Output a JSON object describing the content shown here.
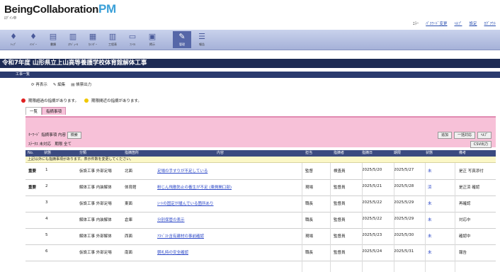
{
  "header": {
    "logo_main": "BeingCollaboration",
    "logo_pm": "PM",
    "subtitle": "ﾛｸﾞｲﾝ中",
    "links": [
      {
        "label": "ｴﾗｰ",
        "link": false
      },
      {
        "label": "ﾊﾟｽﾜｰﾄﾞ変更",
        "link": true
      },
      {
        "label": "ﾍﾙﾌﾟ",
        "link": true
      },
      {
        "label": "設定",
        "link": true
      },
      {
        "label": "ﾛｸﾞｱｳﾄ",
        "link": true
      }
    ]
  },
  "toolbar": {
    "items": [
      {
        "icon": "person-icon",
        "glyph": "♦",
        "label": "ﾄｯﾌﾟ"
      },
      {
        "icon": "person-icon",
        "glyph": "♦",
        "label": "ﾒﾝﾊﾞｰ"
      },
      {
        "icon": "document-icon",
        "glyph": "▤",
        "label": "書類"
      },
      {
        "icon": "chart-icon",
        "glyph": "▥",
        "label": "ｽｹｼﾞｭｰﾙ"
      },
      {
        "icon": "calendar-icon",
        "glyph": "▦",
        "label": "ｶﾚﾝﾀﾞｰ"
      },
      {
        "icon": "chart-icon",
        "glyph": "▥",
        "label": "工程表"
      },
      {
        "icon": "folder-icon",
        "glyph": "▭",
        "label": "ﾌｧｲﾙ"
      },
      {
        "icon": "book-icon",
        "glyph": "▣",
        "label": "掲示"
      },
      {
        "icon": "pencil-icon",
        "glyph": "✎",
        "label": "管理"
      },
      {
        "icon": "list-icon",
        "glyph": "☰",
        "label": "報告"
      }
    ],
    "active_index": 8
  },
  "page_title": "令和7年度 山形県立上山高等養護学校体育館解体工事",
  "section_bar": "工事一覧",
  "actions": [
    {
      "icon": "refresh-icon",
      "label": "再表示"
    },
    {
      "icon": "edit-icon",
      "label": "編集"
    },
    {
      "icon": "report-icon",
      "label": "帳票出力"
    }
  ],
  "legend": {
    "red_text": "期限超過の指摘があります。",
    "yellow_text": "期限間近の指摘があります。"
  },
  "tabs": [
    "一覧",
    "指摘事項"
  ],
  "active_tab": 1,
  "search": {
    "row1_label": "ｷｰﾜｰﾄﾞ 指摘事項 内容",
    "row1_button": "検索",
    "row2_label": "ｽﾃｰﾀｽ 未対応",
    "row2_extra": "期限 全て",
    "right_buttons": [
      "追加",
      "一括対応",
      "ﾍﾙﾌﾟ"
    ],
    "right_button2": "CSV出力"
  },
  "table": {
    "columns": [
      "No.",
      "状態",
      "分類",
      "指摘箇所",
      "内容",
      "担当",
      "指摘者",
      "指摘日",
      "期限",
      "状態",
      "備考"
    ],
    "notice": "上記以外にも指摘事項があります。表示件数を変更してください。",
    "rows": [
      {
        "badge": "重要",
        "no": "1",
        "cat": "仮設工事 外部足場",
        "loc": "北面",
        "desc": "足場の手すりが不足している",
        "who": "監督",
        "by": "検査員",
        "date": "2025/5/20",
        "due": "2025/5/27",
        "status": "未",
        "note": "是正 写真添付"
      },
      {
        "badge": "重要",
        "no": "2",
        "cat": "解体工事 内装解体",
        "loc": "体育館",
        "desc": "粉じん飛散防止の養生が不足 (東側開口部)",
        "who": "現場",
        "by": "監督員",
        "date": "2025/5/21",
        "due": "2025/5/28",
        "status": "済",
        "note": "是正済 確認"
      },
      {
        "badge": "",
        "no": "3",
        "cat": "仮設工事 外部足場",
        "loc": "東面",
        "desc": "ｼｰﾄの固定が緩んでいる箇所あり",
        "who": "職長",
        "by": "監督員",
        "date": "2025/5/22",
        "due": "2025/5/29",
        "status": "未",
        "note": "再確認"
      },
      {
        "badge": "",
        "no": "4",
        "cat": "解体工事 内装解体",
        "loc": "倉庫",
        "desc": "分別保管の表示",
        "who": "職長",
        "by": "監督員",
        "date": "2025/5/22",
        "due": "2025/5/29",
        "status": "未",
        "note": "対応中"
      },
      {
        "badge": "",
        "no": "5",
        "cat": "解体工事 外部解体",
        "loc": "西面",
        "desc": "ｱｽﾍﾞｽﾄ含有建材の事前確認",
        "who": "現場",
        "by": "監督員",
        "date": "2025/5/23",
        "due": "2025/5/30",
        "status": "未",
        "note": "確認中"
      },
      {
        "badge": "",
        "no": "6",
        "cat": "仮設工事 外部足場",
        "loc": "南面",
        "desc": "朝礼時の安全確認",
        "who": "職長",
        "by": "監督員",
        "date": "2025/5/24",
        "due": "2025/5/31",
        "status": "未",
        "note": "報告"
      }
    ]
  },
  "colors": {
    "accent": "#3aa0d8",
    "toolbar": "#b0bbdf",
    "title_bar": "#1d2b55",
    "panel": "#f7c1d8",
    "red": "#e02020",
    "yellow": "#f0c800"
  }
}
